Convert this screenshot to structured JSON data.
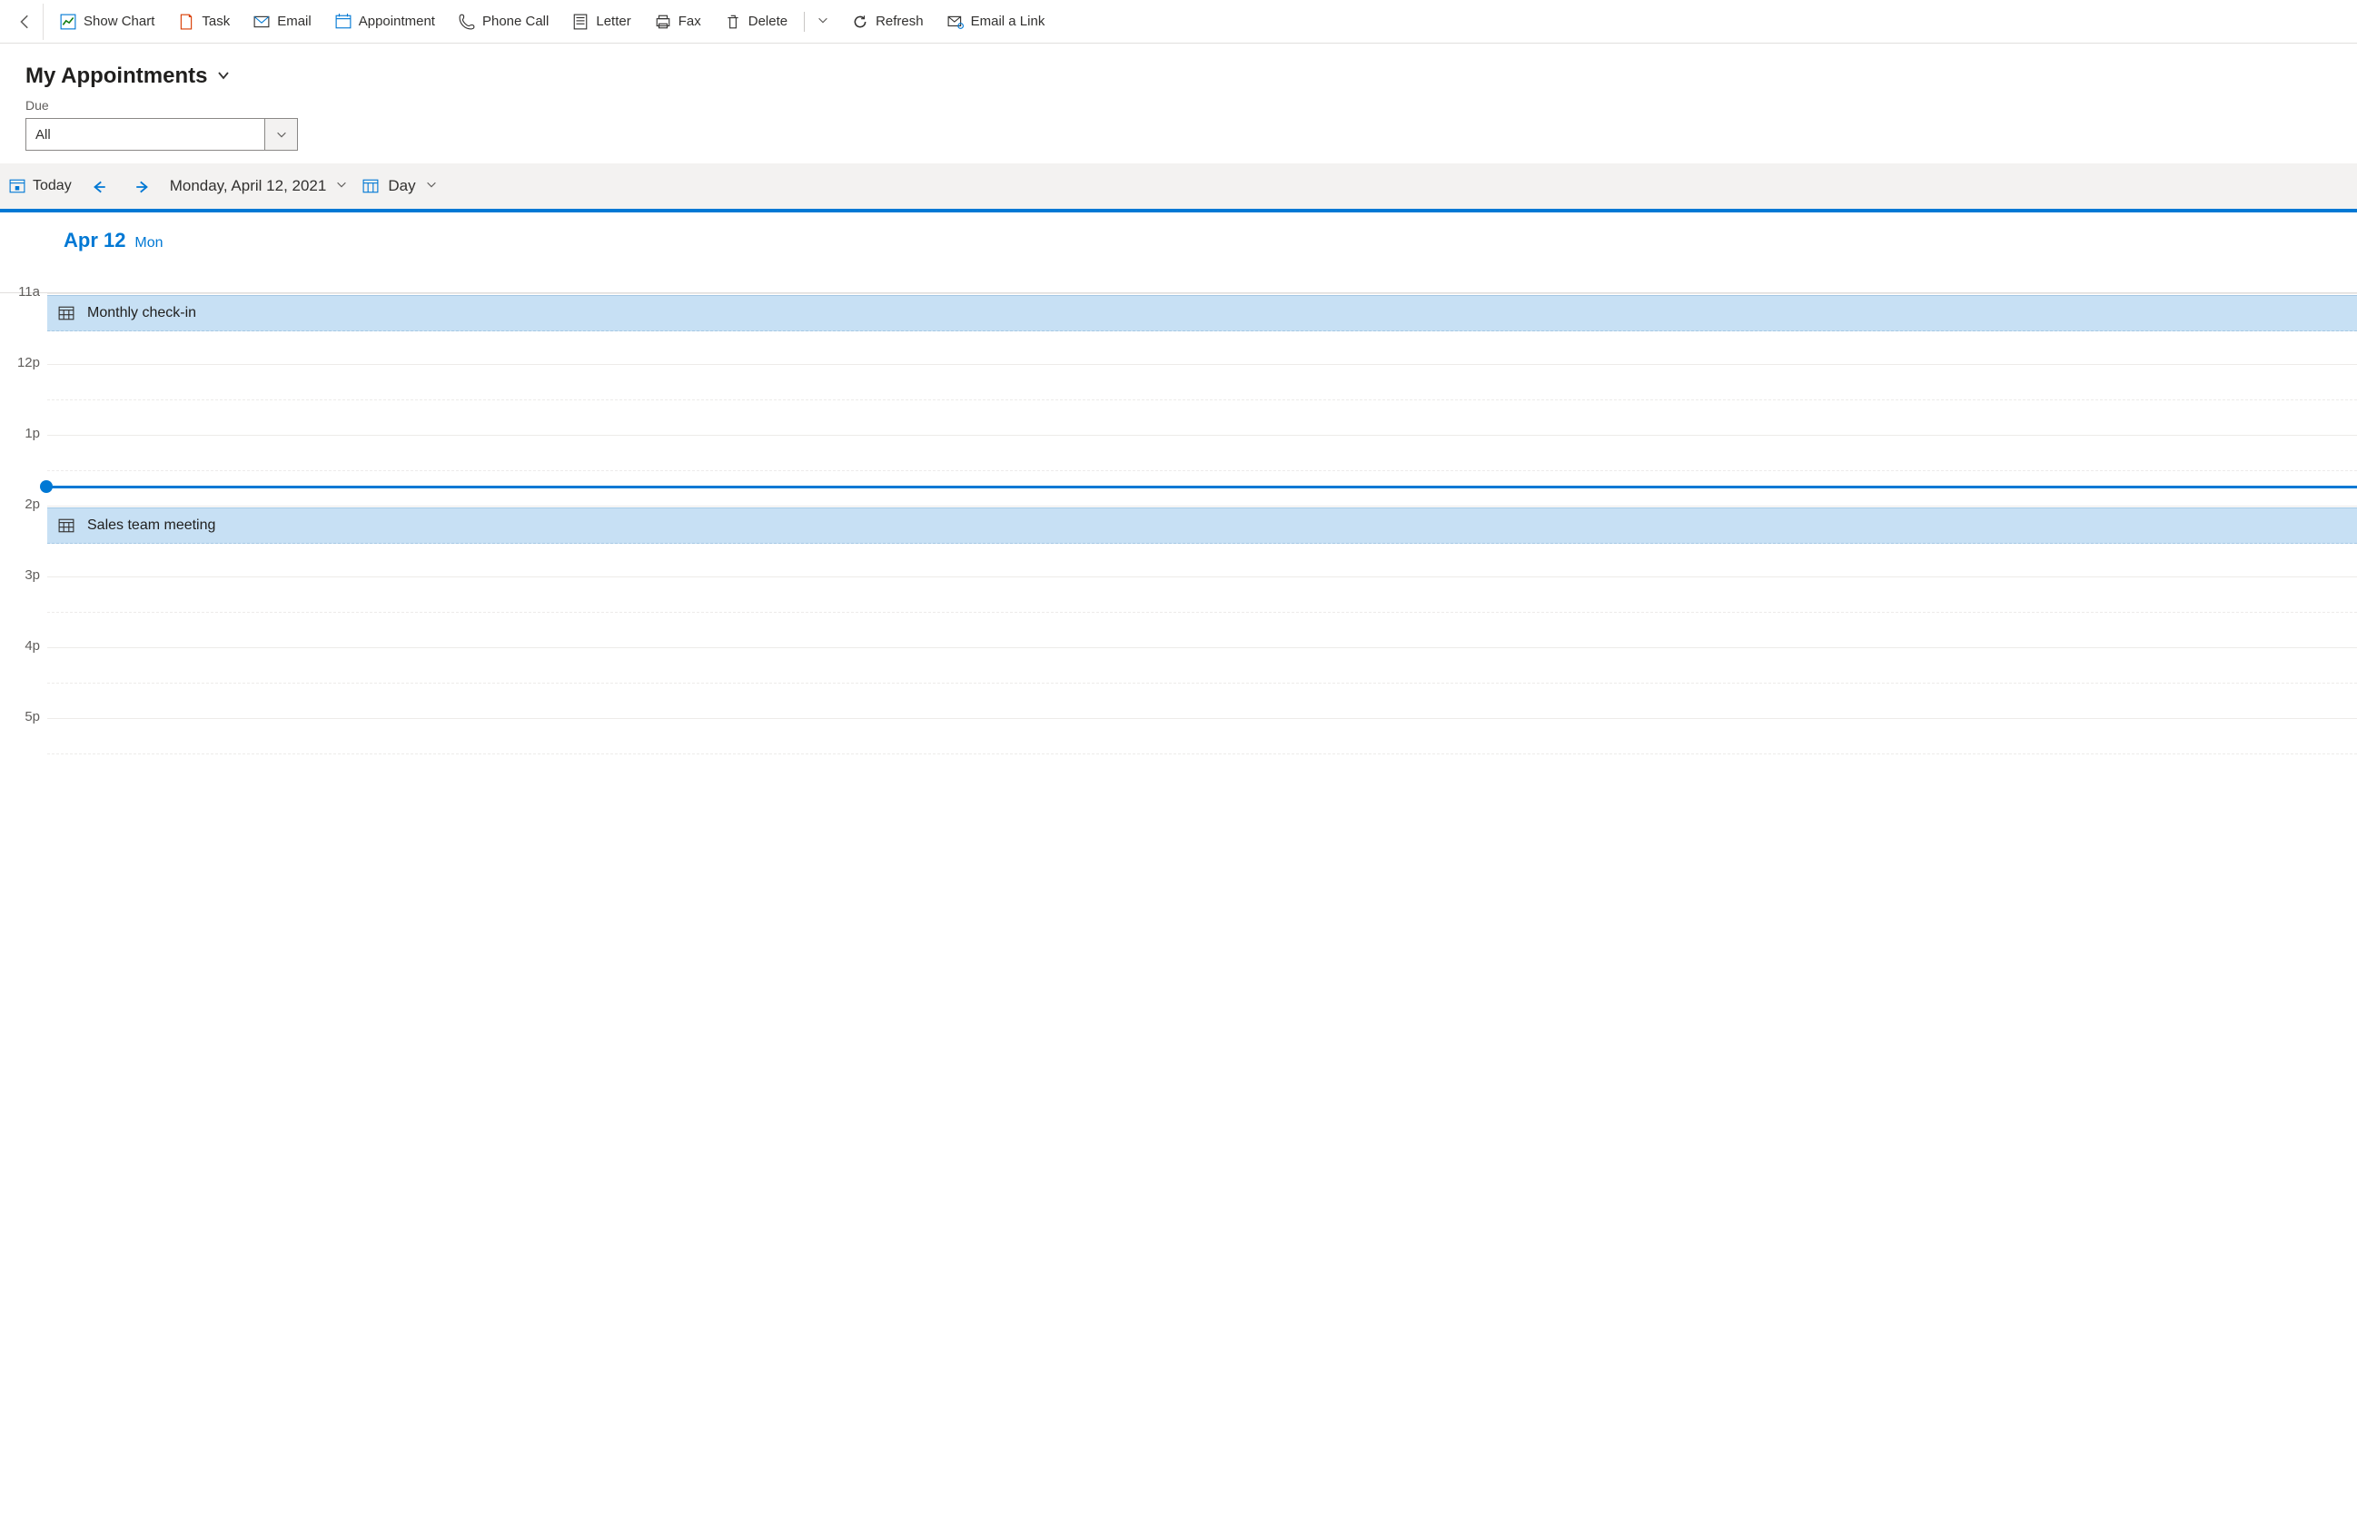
{
  "toolbar": {
    "show_chart": "Show Chart",
    "task": "Task",
    "email": "Email",
    "appointment": "Appointment",
    "phone_call": "Phone Call",
    "letter": "Letter",
    "fax": "Fax",
    "delete": "Delete",
    "refresh": "Refresh",
    "email_link": "Email a Link"
  },
  "view": {
    "title": "My Appointments"
  },
  "filter": {
    "label": "Due",
    "value": "All"
  },
  "nav": {
    "today": "Today",
    "date_long": "Monday, April 12, 2021",
    "view_mode": "Day"
  },
  "day_header": {
    "date": "Apr 12",
    "dow": "Mon"
  },
  "hours": [
    "11a",
    "12p",
    "1p",
    "2p",
    "3p",
    "4p",
    "5p"
  ],
  "appointments": [
    {
      "title": "Monthly check-in",
      "hour_index": 0,
      "half": 0
    },
    {
      "title": "Sales team meeting",
      "hour_index": 3,
      "half": 0
    }
  ],
  "now_marker": {
    "hour_index": 2,
    "fraction": 0.72
  }
}
